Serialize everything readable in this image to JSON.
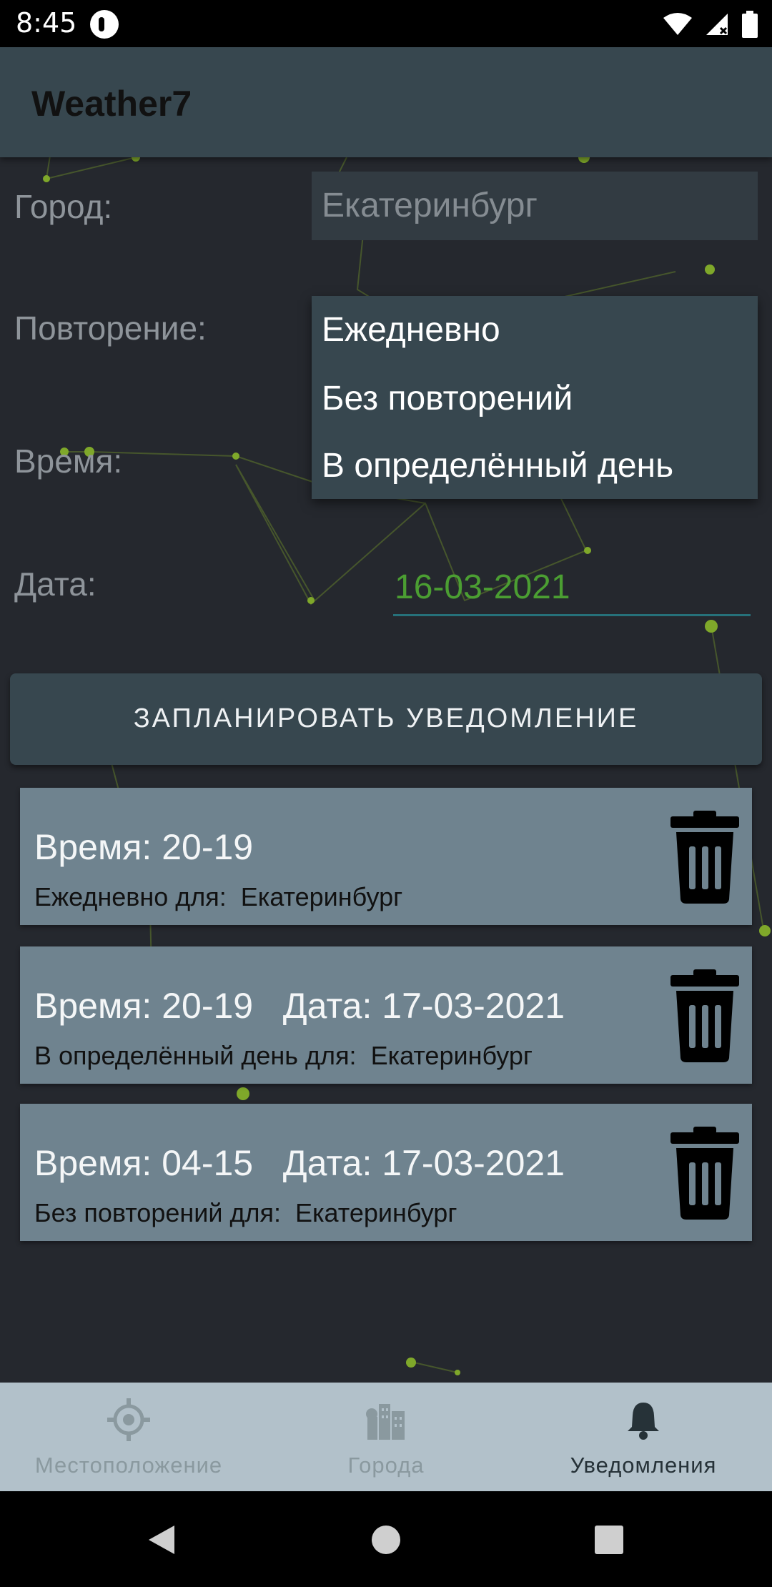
{
  "status_bar": {
    "time": "8:45"
  },
  "app_bar": {
    "title": "Weather7"
  },
  "form": {
    "city_label": "Город:",
    "city_value": "Екатеринбург",
    "repeat_label": "Повторение:",
    "time_label": "Время:",
    "date_label": "Дата:",
    "date_value": "16-03-2021"
  },
  "repeat_dropdown": {
    "options": [
      "Ежедневно",
      "Без повторений",
      "В определённый день"
    ]
  },
  "schedule_button": {
    "label": "ЗАПЛАНИРОВАТЬ УВЕДОМЛЕНИЕ"
  },
  "notifications": [
    {
      "line1": "Время: 20-19",
      "line2": "Ежедневно для:  Екатеринбург"
    },
    {
      "line1": "Время: 20-19   Дата: 17-03-2021",
      "line2": "В определённый день для:  Екатеринбург"
    },
    {
      "line1": "Время: 04-15   Дата: 17-03-2021",
      "line2": "Без повторений для:  Екатеринбург"
    }
  ],
  "bottom_nav": {
    "items": [
      {
        "label": "Местоположение",
        "icon": "location-target-icon",
        "active": false
      },
      {
        "label": "Города",
        "icon": "city-buildings-icon",
        "active": false
      },
      {
        "label": "Уведомления",
        "icon": "bell-icon",
        "active": true
      }
    ]
  },
  "colors": {
    "app_bar": "#37474f",
    "background": "#25282e",
    "card": "#6f838f",
    "accent_green": "#4b9e32",
    "bottom_nav": "#b2c1ca"
  }
}
